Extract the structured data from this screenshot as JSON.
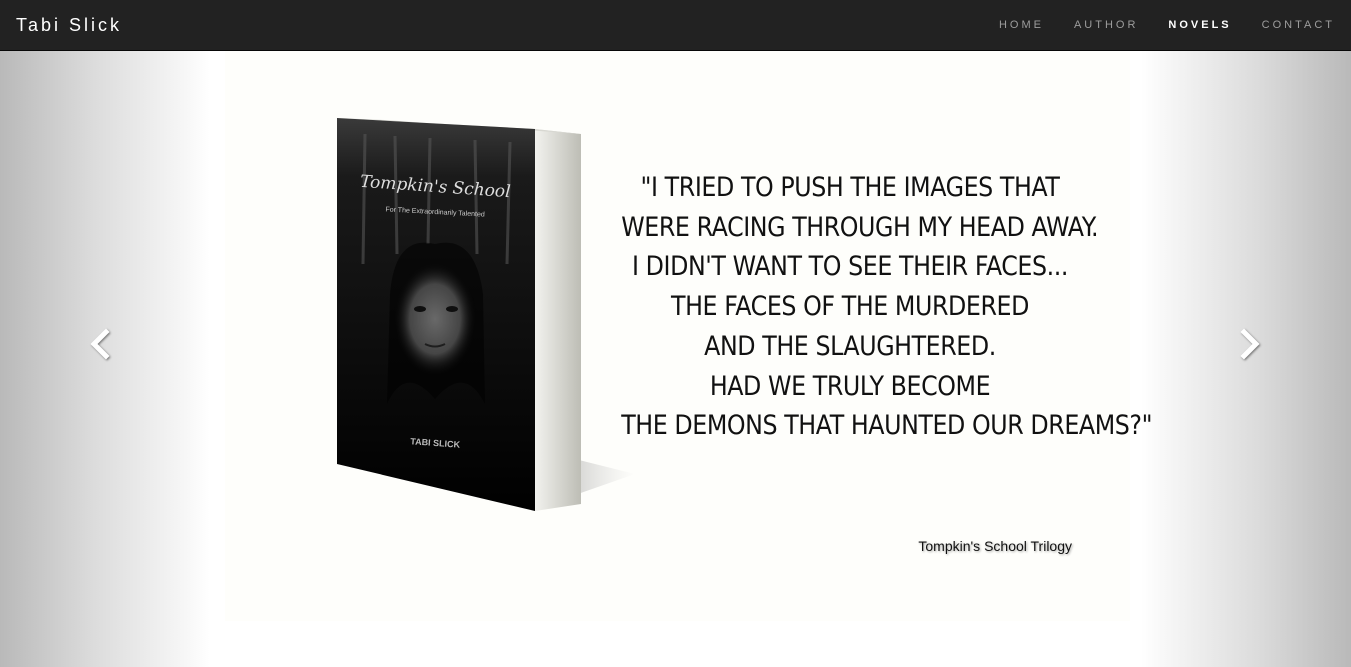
{
  "header": {
    "brand": "Tabi Slick",
    "nav": [
      {
        "label": "HOME",
        "active": false
      },
      {
        "label": "AUTHOR",
        "active": false
      },
      {
        "label": "NOVELS",
        "active": true
      },
      {
        "label": "CONTACT",
        "active": false
      }
    ]
  },
  "carousel": {
    "prev_icon": "chevron-left-icon",
    "next_icon": "chevron-right-icon",
    "slide": {
      "book": {
        "title": "Tompkin's School",
        "subtitle": "For The Extraordinarily Talented",
        "author": "TABI SLICK"
      },
      "quote_lines": [
        "\"I tried to push the images that",
        "were racing through my head away.",
        "I didn't want to see their faces...",
        "The faces of the murdered",
        "and the slaughtered.",
        "Had we truly become",
        "the demons that haunted our dreams?\""
      ],
      "caption": "Tompkin's School Trilogy"
    }
  },
  "colors": {
    "navbar_bg": "#222222",
    "nav_text": "#9d9d9d",
    "nav_active": "#ffffff",
    "book_spine": "#e2e2dc"
  }
}
